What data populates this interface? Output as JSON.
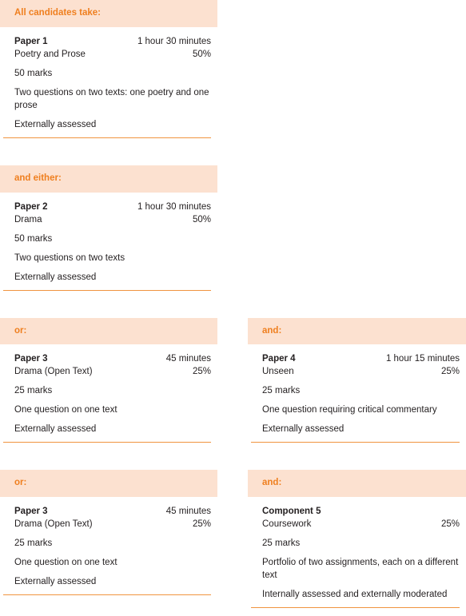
{
  "colors": {
    "header_background": "#fce1d0",
    "header_text": "#ef7f1f",
    "divider": "#f0943f",
    "body_text": "#231f20"
  },
  "rows": [
    {
      "left": {
        "header": "All candidates take:",
        "title": "Paper 1",
        "duration": "1 hour 30 minutes",
        "subtitle": "Poetry and Prose",
        "weighting": "50%",
        "marks": "50 marks",
        "description": "Two questions on two texts: one poetry and one prose",
        "assessment": "Externally assessed"
      },
      "right": null
    },
    {
      "left": {
        "header": "and either:",
        "title": "Paper 2",
        "duration": "1 hour 30 minutes",
        "subtitle": "Drama",
        "weighting": "50%",
        "marks": "50 marks",
        "description": "Two questions on two texts",
        "assessment": "Externally assessed"
      },
      "right": null
    },
    {
      "left": {
        "header": "or:",
        "title": "Paper 3",
        "duration": "45 minutes",
        "subtitle": "Drama (Open Text)",
        "weighting": "25%",
        "marks": "25 marks",
        "description": "One question on one text",
        "assessment": "Externally assessed"
      },
      "right": {
        "header": "and:",
        "title": "Paper 4",
        "duration": "1 hour 15 minutes",
        "subtitle": "Unseen",
        "weighting": "25%",
        "marks": "25 marks",
        "description": "One question requiring critical commentary",
        "assessment": "Externally assessed"
      }
    },
    {
      "left": {
        "header": "or:",
        "title": "Paper 3",
        "duration": "45 minutes",
        "subtitle": "Drama (Open Text)",
        "weighting": "25%",
        "marks": "25 marks",
        "description": "One question on one text",
        "assessment": "Externally assessed"
      },
      "right": {
        "header": "and:",
        "title": "Component 5",
        "duration": "",
        "subtitle": "Coursework",
        "weighting": "25%",
        "marks": "25 marks",
        "description": "Portfolio of two assignments, each on a different text",
        "assessment": "Internally assessed and externally moderated"
      }
    }
  ]
}
